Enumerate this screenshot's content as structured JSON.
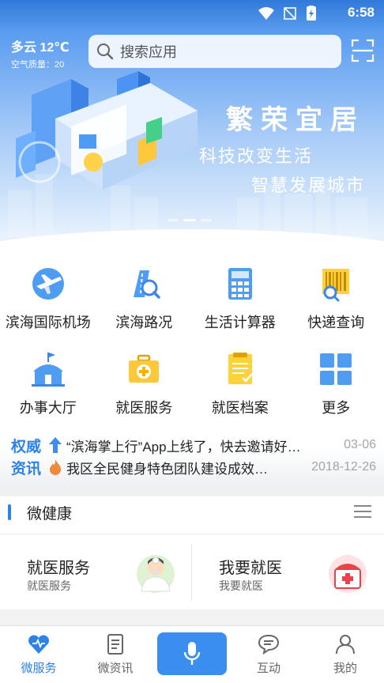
{
  "status": {
    "time": "6:58"
  },
  "weather": {
    "main": "多云  12℃",
    "aqi": "空气质量：20"
  },
  "search": {
    "placeholder": "搜索应用"
  },
  "banner": {
    "title": "繁荣宜居",
    "line1": "科技改变生活",
    "line2": "智慧发展城市",
    "page_count": 3,
    "active_page": 2
  },
  "grid": {
    "items": [
      {
        "label": "滨海国际机场",
        "icon": "airplane-icon"
      },
      {
        "label": "滨海路况",
        "icon": "road-icon"
      },
      {
        "label": "生活计算器",
        "icon": "calculator-icon"
      },
      {
        "label": "快递查询",
        "icon": "barcode-icon"
      },
      {
        "label": "办事大厅",
        "icon": "hall-icon"
      },
      {
        "label": "就医服务",
        "icon": "medical-kit-icon"
      },
      {
        "label": "就医档案",
        "icon": "medical-record-icon"
      },
      {
        "label": "更多",
        "icon": "more-grid-icon"
      }
    ]
  },
  "news": {
    "tag_line1": "权威",
    "tag_line2": "资讯",
    "items": [
      {
        "title": "“滨海掌上行”App上线了，快去邀请好…",
        "date": "03-06",
        "icon": "arrow-up-icon"
      },
      {
        "title": "我区全民健身特色团队建设成效…",
        "date": "2018-12-26",
        "icon": "fire-icon"
      }
    ]
  },
  "section": {
    "title": "微健康"
  },
  "cards": [
    {
      "title": "就医服务",
      "sub": "就医服务",
      "icon": "doctor-icon"
    },
    {
      "title": "我要就医",
      "sub": "我要就医",
      "icon": "medical-box-icon"
    }
  ],
  "tabs": [
    {
      "label": "微服务",
      "icon": "heart-icon",
      "active": true
    },
    {
      "label": "微资讯",
      "icon": "document-icon"
    },
    {
      "label": "",
      "icon": "microphone-icon"
    },
    {
      "label": "互动",
      "icon": "chat-icon"
    },
    {
      "label": "我的",
      "icon": "person-icon"
    }
  ],
  "colors": {
    "accent": "#2c82e8",
    "header": "#2f79d8"
  }
}
